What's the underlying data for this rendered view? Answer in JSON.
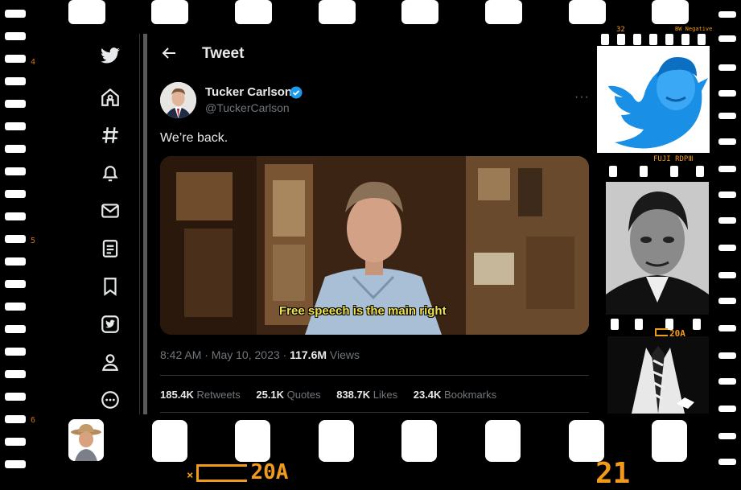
{
  "nav": {
    "items": [
      "twitter-logo",
      "home-icon",
      "explore-hashtag-icon",
      "notifications-bell-icon",
      "messages-envelope-icon",
      "lists-icon",
      "bookmarks-icon",
      "twitter-blue-icon",
      "profile-icon",
      "more-icon"
    ]
  },
  "header": {
    "title": "Tweet"
  },
  "tweet": {
    "author_name": "Tucker Carlson",
    "author_handle": "@TuckerCarlson",
    "text": "We’re back.",
    "video_caption": "Free speech is the main right",
    "time": "8:42 AM · May 10, 2023 · ",
    "views_count": "117.6M",
    "views_label": " Views",
    "retweets_count": "185.4K",
    "retweets_label": " Retweets",
    "quotes_count": "25.1K",
    "quotes_label": " Quotes",
    "likes_count": "838.7K",
    "likes_label": " Likes",
    "bookmarks_count": "23.4K",
    "bookmarks_label": " Bookmarks"
  },
  "film": {
    "left_numbers": [
      "4",
      "5",
      "6"
    ],
    "bottom_code": "20A",
    "bottom_number": "21",
    "right_top_number": "32",
    "right_top_label": "BW Negative",
    "right_mid_label": "FUJI  RDPⅢ",
    "right_code": "20A"
  },
  "colors": {
    "accent": "#1d9bf0",
    "background": "#000000",
    "muted_text": "#71767b",
    "film_orange": "#f29b1b"
  }
}
